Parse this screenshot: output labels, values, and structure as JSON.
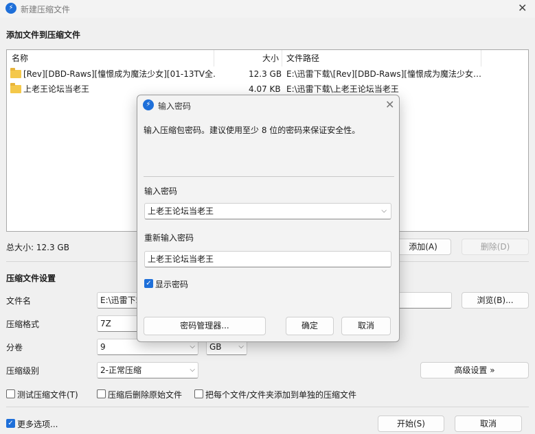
{
  "window": {
    "title": "新建压缩文件"
  },
  "add_section": {
    "title": "添加文件到压缩文件",
    "columns": {
      "name": "名称",
      "size": "大小",
      "path": "文件路径"
    },
    "rows": [
      {
        "name": "[Rev][DBD-Raws][憧憬成为魔法少女][01-13TV全…",
        "size": "12.3 GB",
        "path": "E:\\迅雷下载\\[Rev][DBD-Raws][憧憬成为魔法少女…"
      },
      {
        "name": "上老王论坛当老王",
        "size": "4.07 KB",
        "path": "E:\\迅雷下载\\上老王论坛当老王"
      }
    ],
    "total_size": "总大小: 12.3 GB",
    "add_button": "添加(A)",
    "delete_button": "删除(D)"
  },
  "settings": {
    "title": "压缩文件设置",
    "filename_label": "文件名",
    "filename_value": "E:\\迅雷下载",
    "browse_button": "浏览(B)...",
    "format_label": "压缩格式",
    "format_value": "7Z",
    "split_label": "分卷",
    "split_value": "9",
    "split_unit": "GB",
    "level_label": "压缩级别",
    "level_value": "2-正常压缩",
    "advanced_button": "高级设置 »",
    "test_checkbox": "测试压缩文件(T)",
    "delete_after_checkbox": "压缩后删除原始文件",
    "separate_checkbox": "把每个文件/文件夹添加到单独的压缩文件"
  },
  "footer": {
    "more_options": "更多选项...",
    "start_button": "开始(S)",
    "cancel_button": "取消"
  },
  "password_dialog": {
    "title": "输入密码",
    "description": "输入压缩包密码。建议使用至少 8 位的密码来保证安全性。",
    "password_label": "输入密码",
    "password_value": "上老王论坛当老王",
    "confirm_label": "重新输入密码",
    "confirm_value": "上老王论坛当老王",
    "show_password": "显示密码",
    "manager_button": "密码管理器...",
    "ok_button": "确定",
    "cancel_button": "取消"
  },
  "colors": {
    "accent": "#1e6fd9",
    "folder": "#f4c84a"
  }
}
